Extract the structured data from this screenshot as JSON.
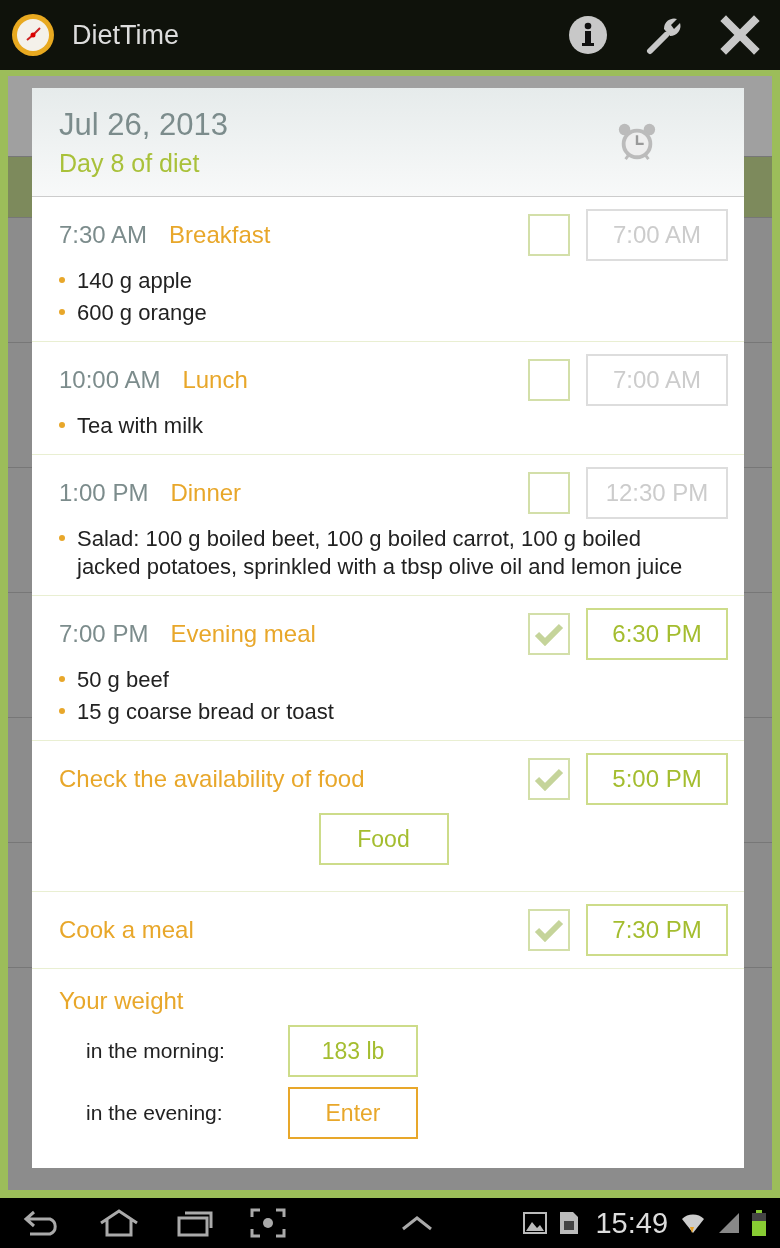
{
  "app_bar": {
    "title": "DietTime"
  },
  "dialog": {
    "date": "Jul 26, 2013",
    "day": "Day 8 of diet",
    "entries": [
      {
        "kind": "meal",
        "time": "7:30 AM",
        "name": "Breakfast",
        "checked": false,
        "reminder": "7:00 AM",
        "items": [
          "140 g apple",
          "600 g orange"
        ]
      },
      {
        "kind": "meal",
        "time": "10:00 AM",
        "name": "Lunch",
        "checked": false,
        "reminder": "7:00 AM",
        "items": [
          "Tea with milk"
        ]
      },
      {
        "kind": "meal",
        "time": "1:00 PM",
        "name": "Dinner",
        "checked": false,
        "reminder": "12:30 PM",
        "items": [
          "Salad: 100 g boiled beet, 100 g boiled carrot, 100 g boiled jacked potatoes, sprinkled with a tbsp olive oil and lemon juice"
        ]
      },
      {
        "kind": "meal",
        "time": "7:00 PM",
        "name": "Evening meal",
        "checked": true,
        "reminder": "6:30 PM",
        "items": [
          "50 g beef",
          "15 g coarse bread or toast"
        ]
      },
      {
        "kind": "task",
        "name": "Check the availability of food",
        "checked": true,
        "reminder": "5:00 PM",
        "button": "Food"
      },
      {
        "kind": "task",
        "name": "Cook a meal",
        "checked": true,
        "reminder": "7:30 PM"
      }
    ],
    "weight": {
      "title": "Your weight",
      "rows": [
        {
          "label": "in the morning:",
          "value": "183 lb",
          "kind": "value"
        },
        {
          "label": "in the evening:",
          "value": "Enter",
          "kind": "action"
        }
      ]
    }
  },
  "status_bar": {
    "time": "15:49"
  }
}
